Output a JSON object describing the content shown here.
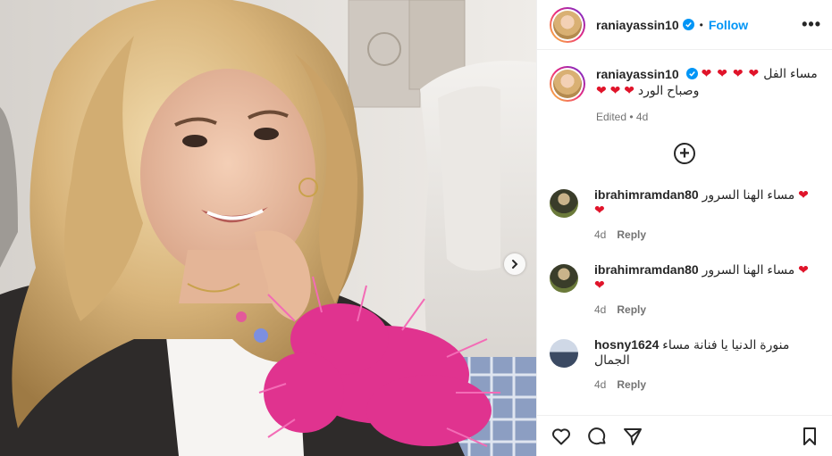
{
  "post": {
    "author": "raniayassin10",
    "follow_label": "Follow",
    "separator": "•",
    "more_label": "•••"
  },
  "caption": {
    "username": "raniayassin10",
    "line1": "مساء الفل",
    "line1_hearts": "❤ ❤ ❤ ❤",
    "line2": "وصباح الورد",
    "line2_hearts": "❤ ❤ ❤",
    "edited": "Edited",
    "age": "4d"
  },
  "add_comment_label": "+",
  "comments": [
    {
      "username": "ibrahimramdan80",
      "text": "مساء الهنا السرور",
      "hearts": "❤ ❤",
      "age": "4d",
      "reply": "Reply"
    },
    {
      "username": "ibrahimramdan80",
      "text": "مساء الهنا السرور",
      "hearts": "❤ ❤",
      "age": "4d",
      "reply": "Reply"
    },
    {
      "username": "hosny1624",
      "text": "منورة الدنيا يا فنانة مساء الجمال",
      "age": "4d",
      "reply": "Reply"
    }
  ],
  "colors": {
    "accent": "#0095f6",
    "heart": "#e0142a",
    "muted": "#737373",
    "text": "#262626"
  },
  "icons": [
    "verified-badge-icon",
    "more-options-icon",
    "add-comment-icon",
    "next-slide-icon",
    "like-icon",
    "comment-icon",
    "share-icon",
    "save-icon"
  ]
}
